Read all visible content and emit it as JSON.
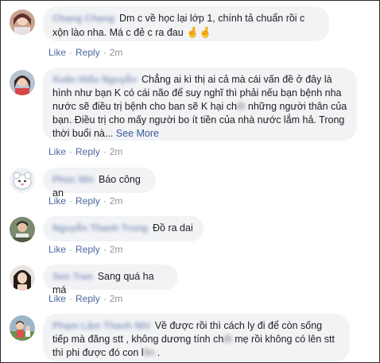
{
  "comments": [
    {
      "author": "Chang Chang",
      "text": "Dm c về học lại lớp 1, chính tả chuẩn rồi c xộn lào nha. Má c đẻ c ra đau",
      "emoji": "🤞🤞",
      "like_label": "Like",
      "reply_label": "Reply",
      "time": "2m"
    },
    {
      "author": "Xuân Hiểu Nguyễn",
      "text_before": "Chẳng ai kì thị ai cả mà cái vấn đề ở đây là hình như bạn K có cái não để suy nghĩ thì phải nếu bạn bệnh nha nước sẽ điều trị bệnh cho ban sẽ K hại ch",
      "text_hidden": "ết",
      "text_after": " những người thân của bạn. Điều trị cho mấy người bo ít tiền của nhà nước lắm hả. Trong thời buổi nà... ",
      "see_more": "See More",
      "like_label": "Like",
      "reply_label": "Reply",
      "time": "2m"
    },
    {
      "author": "Phúc Nhi",
      "text": "Báo công an",
      "like_label": "Like",
      "reply_label": "Reply",
      "time": "2m"
    },
    {
      "author": "Nguyễn Thanh Trung",
      "text": "Đồ ra dai",
      "like_label": "Like",
      "reply_label": "Reply",
      "time": "2m"
    },
    {
      "author": "Sen Tran",
      "text": "Sang quá ha má",
      "like_label": "Like",
      "reply_label": "Reply",
      "time": "2m"
    },
    {
      "author": "Phạm Lâm Thanh Nhi",
      "text_before": "Về được rồi thì cách ly đi để còn sống tiếp mà đăng stt , không dương tính ch",
      "text_hidden": "ết",
      "text_middle": " mẹ rồi không có lên stt thì phi được đó con l",
      "text_hidden2": "ồn",
      "text_after": " ."
    }
  ]
}
